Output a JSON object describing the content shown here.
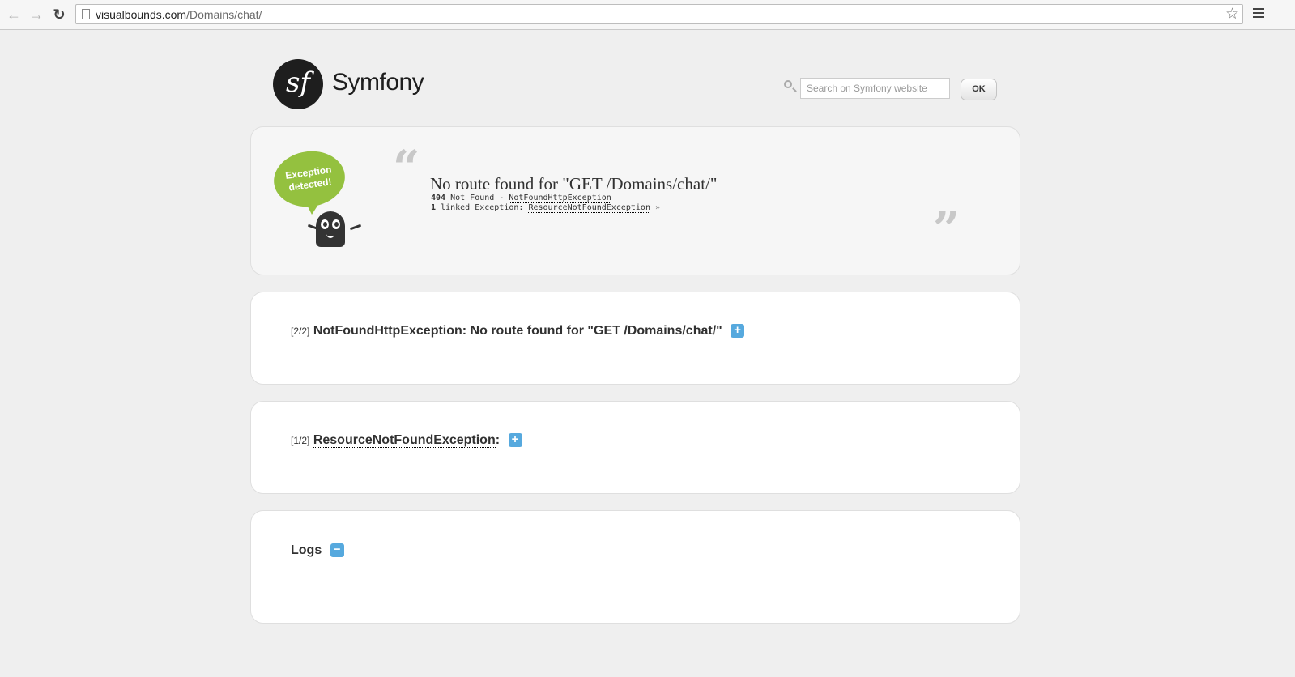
{
  "browser": {
    "url_host": "visualbounds.com",
    "url_path": "/Domains/chat/"
  },
  "header": {
    "logo_mark": "sf",
    "logo_text": "Symfony",
    "search_placeholder": "Search on Symfony website",
    "search_button": "OK"
  },
  "exception": {
    "bubble_text": "Exception detected!",
    "title": "No route found for \"GET /Domains/chat/\"",
    "status_code": "404",
    "status_text": "Not Found -",
    "class_name": "NotFoundHttpException",
    "linked_count": "1",
    "linked_label": "linked Exception:",
    "linked_class": "ResourceNotFoundException",
    "linked_more": "»"
  },
  "blocks": [
    {
      "counter": "[2/2]",
      "class_name": "NotFoundHttpException",
      "message": ": No route found for \"GET /Domains/chat/\"",
      "toggle": "+"
    },
    {
      "counter": "[1/2]",
      "class_name": "ResourceNotFoundException",
      "message": ":",
      "toggle": "+"
    }
  ],
  "logs": {
    "title": "Logs",
    "toggle": "−"
  },
  "colors": {
    "accent_green": "#94c13f",
    "toggle_blue": "#56a9de"
  }
}
